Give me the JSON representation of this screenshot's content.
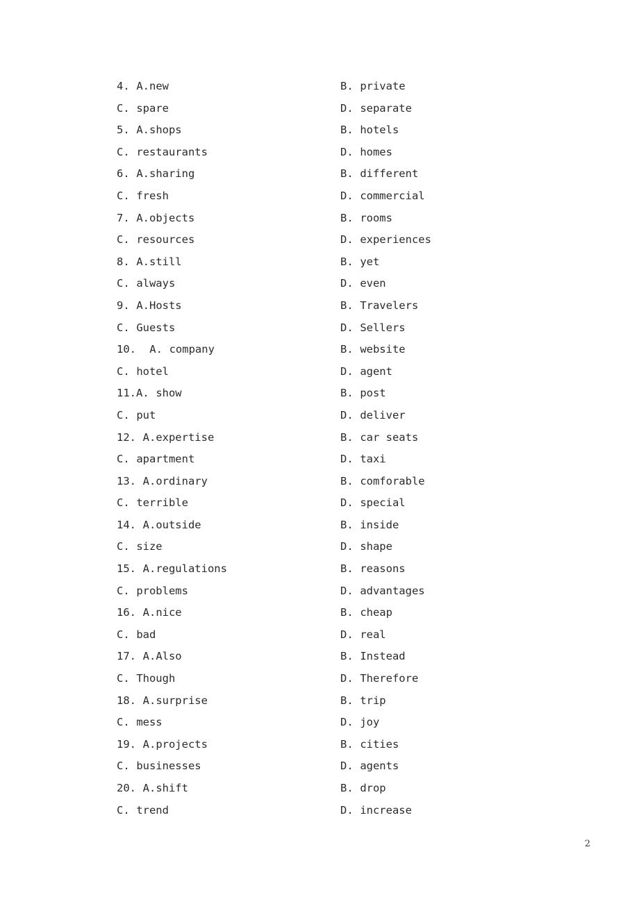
{
  "page": {
    "page_number": "2",
    "background_color": "#ffffff",
    "text_color": "#2b2b2b"
  },
  "questions": [
    {
      "number": "4.",
      "number_gap": " ",
      "a_gap": "",
      "options": [
        {
          "letter": "A.",
          "text": "new"
        },
        {
          "letter": "B.",
          "text": "private"
        },
        {
          "letter": "C.",
          "text": "spare"
        },
        {
          "letter": "D.",
          "text": "separate"
        }
      ]
    },
    {
      "number": "5.",
      "number_gap": " ",
      "a_gap": "",
      "options": [
        {
          "letter": "A.",
          "text": "shops"
        },
        {
          "letter": "B.",
          "text": "hotels"
        },
        {
          "letter": "C.",
          "text": "restaurants"
        },
        {
          "letter": "D.",
          "text": "homes"
        }
      ]
    },
    {
      "number": "6.",
      "number_gap": " ",
      "a_gap": "",
      "options": [
        {
          "letter": "A.",
          "text": "sharing"
        },
        {
          "letter": "B.",
          "text": "different"
        },
        {
          "letter": "C.",
          "text": "fresh"
        },
        {
          "letter": "D.",
          "text": "commercial"
        }
      ]
    },
    {
      "number": "7.",
      "number_gap": " ",
      "a_gap": "",
      "options": [
        {
          "letter": "A.",
          "text": "objects"
        },
        {
          "letter": "B.",
          "text": "rooms"
        },
        {
          "letter": "C.",
          "text": "resources"
        },
        {
          "letter": "D.",
          "text": "experiences"
        }
      ]
    },
    {
      "number": "8.",
      "number_gap": " ",
      "a_gap": "",
      "options": [
        {
          "letter": "A.",
          "text": "still"
        },
        {
          "letter": "B.",
          "text": "yet"
        },
        {
          "letter": "C.",
          "text": "always"
        },
        {
          "letter": "D.",
          "text": "even"
        }
      ]
    },
    {
      "number": "9.",
      "number_gap": " ",
      "a_gap": "",
      "options": [
        {
          "letter": "A.",
          "text": "Hosts"
        },
        {
          "letter": "B.",
          "text": "Travelers"
        },
        {
          "letter": "C.",
          "text": "Guests"
        },
        {
          "letter": "D.",
          "text": "Sellers"
        }
      ]
    },
    {
      "number": "10.",
      "number_gap": "  ",
      "a_gap": " ",
      "options": [
        {
          "letter": "A.",
          "text": "company"
        },
        {
          "letter": "B.",
          "text": "website"
        },
        {
          "letter": "C.",
          "text": "hotel"
        },
        {
          "letter": "D.",
          "text": "agent"
        }
      ]
    },
    {
      "number": "11.",
      "number_gap": "",
      "a_gap": " ",
      "options": [
        {
          "letter": "A.",
          "text": "show"
        },
        {
          "letter": "B.",
          "text": "post"
        },
        {
          "letter": "C.",
          "text": "put"
        },
        {
          "letter": "D.",
          "text": "deliver"
        }
      ]
    },
    {
      "number": "12.",
      "number_gap": " ",
      "a_gap": "",
      "options": [
        {
          "letter": "A.",
          "text": "expertise"
        },
        {
          "letter": "B.",
          "text": "car seats"
        },
        {
          "letter": "C.",
          "text": "apartment"
        },
        {
          "letter": "D.",
          "text": "taxi"
        }
      ]
    },
    {
      "number": "13.",
      "number_gap": " ",
      "a_gap": "",
      "options": [
        {
          "letter": "A.",
          "text": "ordinary"
        },
        {
          "letter": "B.",
          "text": "comforable"
        },
        {
          "letter": "C.",
          "text": "terrible"
        },
        {
          "letter": "D.",
          "text": "special"
        }
      ]
    },
    {
      "number": "14.",
      "number_gap": " ",
      "a_gap": "",
      "options": [
        {
          "letter": "A.",
          "text": "outside"
        },
        {
          "letter": "B.",
          "text": "inside"
        },
        {
          "letter": "C.",
          "text": "size"
        },
        {
          "letter": "D.",
          "text": "shape"
        }
      ]
    },
    {
      "number": "15.",
      "number_gap": " ",
      "a_gap": "",
      "options": [
        {
          "letter": "A.",
          "text": "regulations"
        },
        {
          "letter": "B.",
          "text": "reasons"
        },
        {
          "letter": "C.",
          "text": "problems"
        },
        {
          "letter": "D.",
          "text": "advantages"
        }
      ]
    },
    {
      "number": "16.",
      "number_gap": " ",
      "a_gap": "",
      "options": [
        {
          "letter": "A.",
          "text": "nice"
        },
        {
          "letter": "B.",
          "text": "cheap"
        },
        {
          "letter": "C.",
          "text": "bad"
        },
        {
          "letter": "D.",
          "text": "real"
        }
      ]
    },
    {
      "number": "17.",
      "number_gap": " ",
      "a_gap": "",
      "options": [
        {
          "letter": "A.",
          "text": "Also"
        },
        {
          "letter": "B.",
          "text": "Instead"
        },
        {
          "letter": "C.",
          "text": "Though"
        },
        {
          "letter": "D.",
          "text": "Therefore"
        }
      ]
    },
    {
      "number": "18.",
      "number_gap": " ",
      "a_gap": "",
      "options": [
        {
          "letter": "A.",
          "text": "surprise"
        },
        {
          "letter": "B.",
          "text": "trip"
        },
        {
          "letter": "C.",
          "text": "mess"
        },
        {
          "letter": "D.",
          "text": "joy"
        }
      ]
    },
    {
      "number": "19.",
      "number_gap": " ",
      "a_gap": "",
      "options": [
        {
          "letter": "A.",
          "text": "projects"
        },
        {
          "letter": "B.",
          "text": "cities"
        },
        {
          "letter": "C.",
          "text": "businesses"
        },
        {
          "letter": "D.",
          "text": "agents"
        }
      ]
    },
    {
      "number": "20.",
      "number_gap": " ",
      "a_gap": "",
      "options": [
        {
          "letter": "A.",
          "text": "shift"
        },
        {
          "letter": "B.",
          "text": "drop"
        },
        {
          "letter": "C.",
          "text": "trend"
        },
        {
          "letter": "D.",
          "text": "increase"
        }
      ]
    }
  ]
}
